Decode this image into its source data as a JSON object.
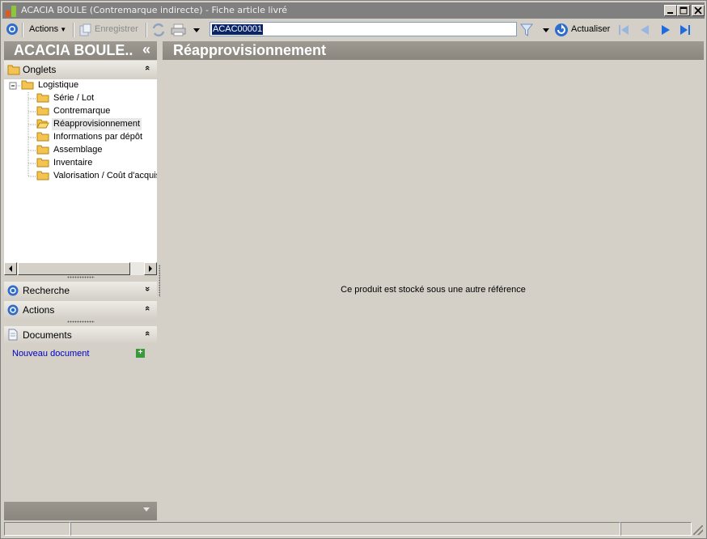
{
  "window": {
    "title": "ACACIA BOULE (Contremarque indirecte) - Fiche article livré",
    "buttons": [
      "minimize",
      "maximize",
      "close"
    ]
  },
  "toolbar": {
    "actions_label": "Actions",
    "save_label": "Enregistrer",
    "code_value": "ACAC00001",
    "refresh_label": "Actualiser"
  },
  "left_panel": {
    "header_title": "ACACIA BOULE..",
    "collapse_glyph": "«",
    "tabs_section": {
      "label": "Onglets",
      "chevron": "«"
    },
    "tree": {
      "root": "Logistique",
      "children": [
        {
          "label": "Série / Lot",
          "selected": false
        },
        {
          "label": "Contremarque",
          "selected": false
        },
        {
          "label": "Réapprovisionnement",
          "selected": true
        },
        {
          "label": "Informations par dépôt",
          "selected": false
        },
        {
          "label": "Assemblage",
          "selected": false
        },
        {
          "label": "Inventaire",
          "selected": false
        },
        {
          "label": "Valorisation / Coût d'acquis",
          "selected": false
        }
      ]
    },
    "search_section": {
      "label": "Recherche",
      "chevron": "»"
    },
    "actions_section": {
      "label": "Actions",
      "chevron": "«"
    },
    "documents_section": {
      "label": "Documents",
      "chevron": "«"
    },
    "new_document_label": "Nouveau document"
  },
  "main": {
    "title": "Réapprovisionnement",
    "message": "Ce produit est stocké sous une autre référence"
  },
  "colors": {
    "header_gray": "#8f8b83",
    "face": "#d4d0c8",
    "link_blue": "#0000c0",
    "selection": "#0a246a"
  }
}
